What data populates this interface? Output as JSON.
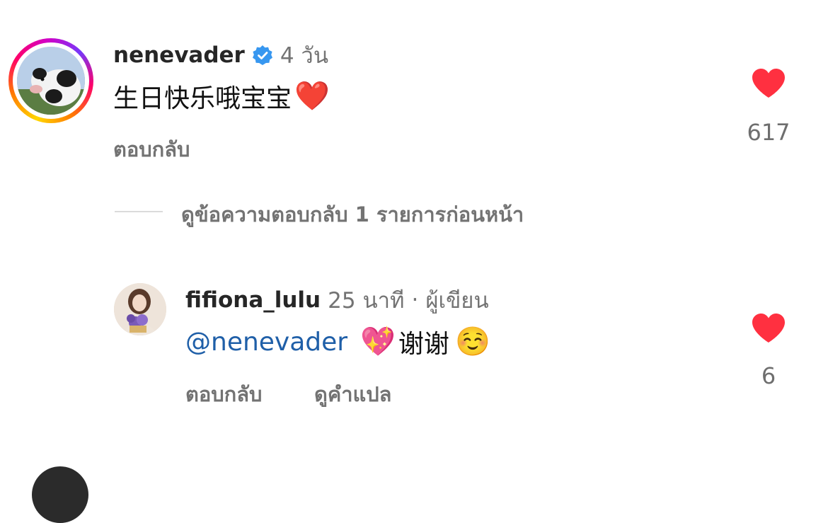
{
  "comment": {
    "username": "nenevader",
    "time": "4 วัน",
    "text": "生日快乐哦宝宝",
    "emoji": "❤️",
    "reply_label": "ตอบกลับ",
    "like_count": "617"
  },
  "view_replies": {
    "label": "ดูข้อความตอบกลับ 1 รายการก่อนหน้า"
  },
  "reply": {
    "username": "fifiona_lulu",
    "time": "25 นาที",
    "separator": "·",
    "author_tag": "ผู้เขียน",
    "mention": "@nenevader",
    "emoji_heart": "💖",
    "text": "谢谢",
    "emoji_smile": "☺️",
    "reply_label": "ตอบกลับ",
    "translate_label": "ดูคำแปล",
    "like_count": "6"
  },
  "colors": {
    "like_heart": "#ff3040",
    "verified": "#3797f0",
    "mention": "#1f5fa8",
    "muted": "#737373"
  },
  "icons": {
    "verified": "verified-badge-icon",
    "like": "heart-filled-icon"
  }
}
